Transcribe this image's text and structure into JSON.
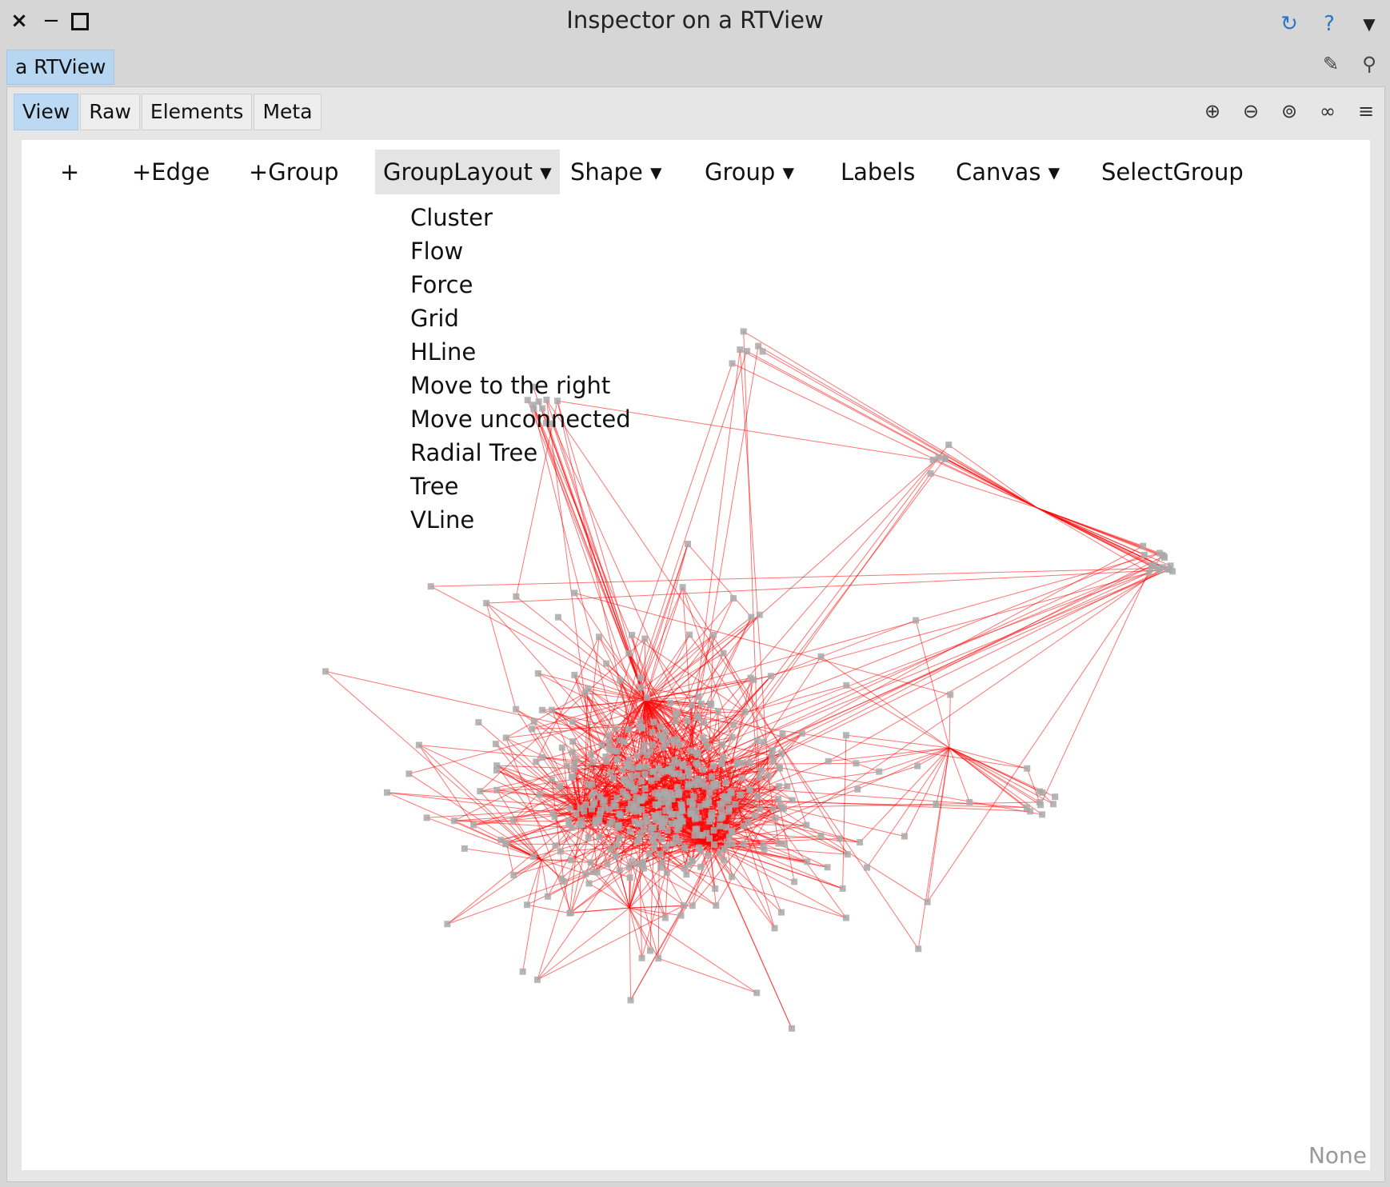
{
  "window": {
    "title": "Inspector on a RTView",
    "close_glyph": "×",
    "minimize_glyph": "−",
    "right_icons": [
      "refresh-icon",
      "help-icon",
      "chevron-down-icon"
    ]
  },
  "object_tab": {
    "label": "a RTView"
  },
  "tabbar_icons": [
    "edit-icon",
    "search-icon"
  ],
  "presentation_tabs": [
    {
      "label": "View",
      "active": true
    },
    {
      "label": "Raw",
      "active": false
    },
    {
      "label": "Elements",
      "active": false
    },
    {
      "label": "Meta",
      "active": false
    }
  ],
  "presentation_icons": [
    "zoom-in-icon",
    "zoom-out-icon",
    "zoom-fit-icon",
    "glasses-icon",
    "menu-icon"
  ],
  "menu": {
    "items": [
      "+",
      "+Edge",
      "+Group",
      "GroupLayout ▾",
      "Shape ▾",
      "Group ▾",
      "Labels",
      "Canvas ▾",
      "SelectGroup"
    ],
    "open_item": "GroupLayout ▾"
  },
  "group_layout_options": [
    "Cluster",
    "Flow",
    "Force",
    "Grid",
    "HLine",
    "Move to the right",
    "Move unconnected",
    "Radial Tree",
    "Tree",
    "VLine"
  ],
  "status": "None",
  "colors": {
    "edge": "#ff0000",
    "node": "#a9a9a9",
    "selected_tab": "#bcd9f3"
  }
}
